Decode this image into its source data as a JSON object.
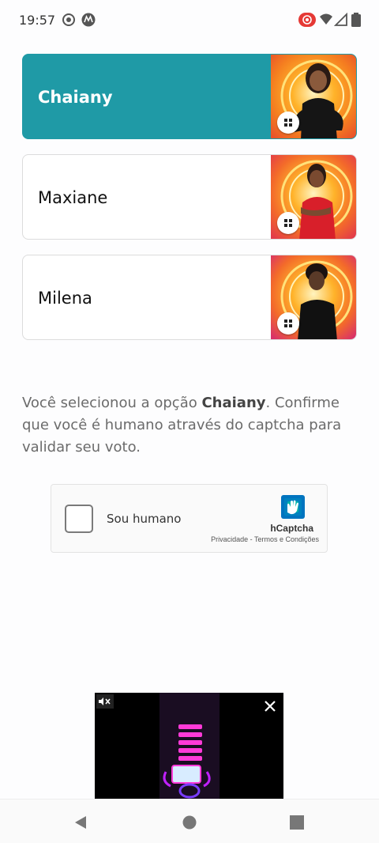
{
  "status": {
    "time": "19:57",
    "icons": [
      "record-icon",
      "motorola-icon",
      "screen-record-icon",
      "wifi-icon",
      "signal-icon",
      "battery-icon"
    ]
  },
  "options": [
    {
      "name": "Chaiany",
      "selected": true,
      "accent": "#1f9aa6"
    },
    {
      "name": "Maxiane",
      "selected": false
    },
    {
      "name": "Milena",
      "selected": false
    }
  ],
  "message": {
    "prefix": "Você selecionou a opção ",
    "option": "Chaiany",
    "suffix": ". Confirme que você é humano através do captcha para validar seu voto."
  },
  "captcha": {
    "label": "Sou humano",
    "brand": "hCaptcha",
    "links": "Privacidade - Termos e Condições"
  },
  "ad": {
    "icons": [
      "mute-icon",
      "close-icon"
    ]
  },
  "nav": {
    "icons": [
      "back-icon",
      "home-icon",
      "recents-icon"
    ]
  }
}
